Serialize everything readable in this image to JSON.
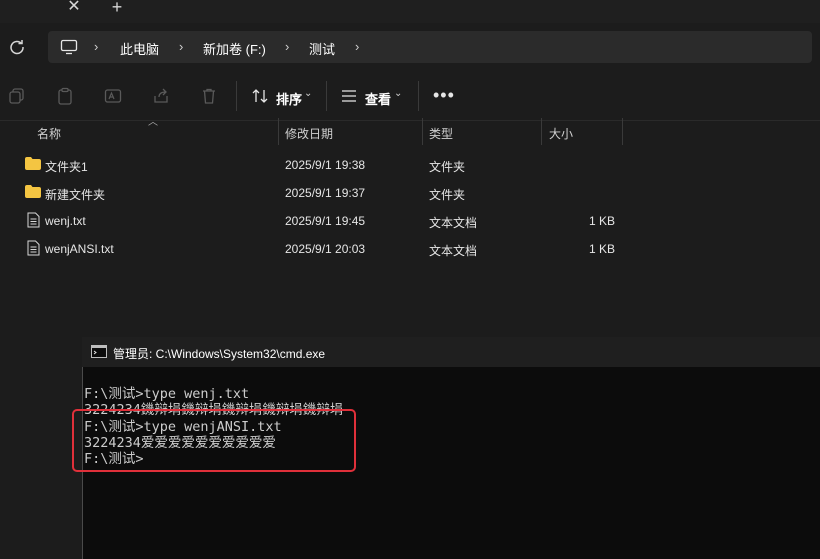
{
  "tabs": {
    "close_glyph": "✕",
    "new_tab_glyph": "+"
  },
  "address_bar": {
    "crumbs": [
      "此电脑",
      "新加卷 (F:)",
      "测试"
    ]
  },
  "toolbar": {
    "sort_label": "排序",
    "view_label": "查看"
  },
  "columns": {
    "name": "名称",
    "modified": "修改日期",
    "type": "类型",
    "size": "大小"
  },
  "files": [
    {
      "name": "文件夹1",
      "modified": "2025/9/1 19:38",
      "type": "文件夹",
      "size": "",
      "icon": "folder-icon"
    },
    {
      "name": "新建文件夹",
      "modified": "2025/9/1 19:37",
      "type": "文件夹",
      "size": "",
      "icon": "folder-icon"
    },
    {
      "name": "wenj.txt",
      "modified": "2025/9/1 19:45",
      "type": "文本文档",
      "size": "1 KB",
      "icon": "text-file-icon"
    },
    {
      "name": "wenjANSI.txt",
      "modified": "2025/9/1 20:03",
      "type": "文本文档",
      "size": "1 KB",
      "icon": "text-file-icon"
    }
  ],
  "cmd": {
    "title": "管理员: C:\\Windows\\System32\\cmd.exe",
    "lines": [
      "F:\\测试>type wenj.txt",
      "3224234鐖辩埍鐖辩埍鐖辩埍鐖辩埍鐖辩埍",
      "F:\\测试>type wenjANSI.txt",
      "3224234爱爱爱爱爱爱爱爱爱爱",
      "F:\\测试>"
    ]
  },
  "colors": {
    "highlight_box": "#e0303a",
    "folder": "#f4c542",
    "console_bg": "#0c0c0c"
  }
}
